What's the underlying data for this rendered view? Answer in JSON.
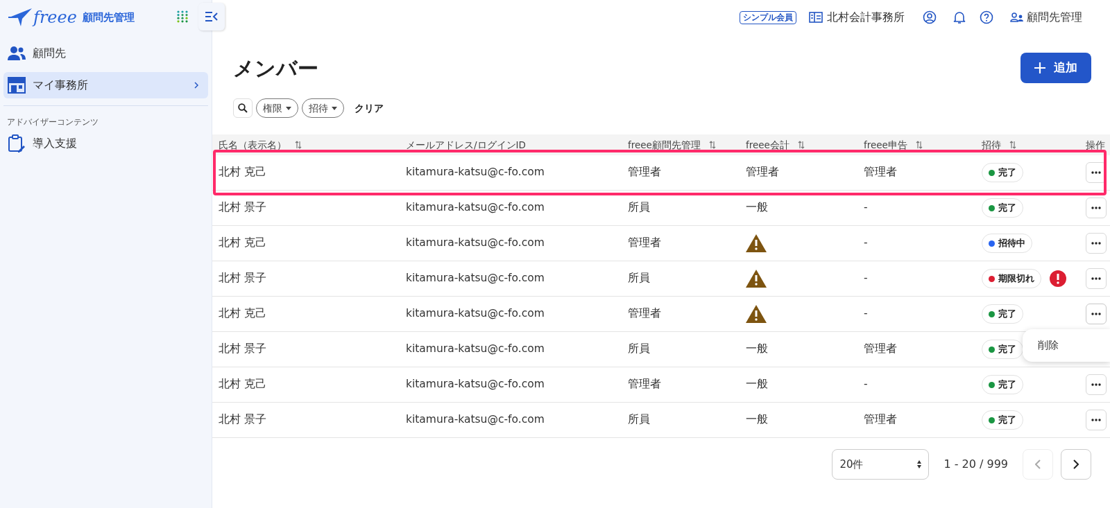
{
  "sidebar": {
    "logo": {
      "brand": "freee",
      "product": "顧問先管理"
    },
    "nav": [
      {
        "label": "顧問先",
        "kind": "people",
        "selected": false,
        "chevron": false
      },
      {
        "label": "マイ事務所",
        "kind": "shop",
        "selected": true,
        "chevron": true
      }
    ],
    "section_label": "アドバイザーコンテンツ",
    "section_items": [
      {
        "label": "導入支援",
        "kind": "clipboard"
      }
    ]
  },
  "topbar": {
    "plan_badge": "シンプル会員",
    "office": "北村会計事務所",
    "user_label": "顧問先管理"
  },
  "page": {
    "title": "メンバー",
    "add_button": "追加",
    "filters": [
      {
        "label": "権限"
      },
      {
        "label": "招待"
      }
    ],
    "clear": "クリア"
  },
  "table": {
    "columns": [
      {
        "label": "氏名（表示名）",
        "sortable": true
      },
      {
        "label": "メールアドレス/ログインID",
        "sortable": false
      },
      {
        "label": "freee顧問先管理",
        "sortable": true
      },
      {
        "label": "freee会計",
        "sortable": true
      },
      {
        "label": "freee申告",
        "sortable": true
      },
      {
        "label": "招待",
        "sortable": true
      },
      {
        "label": "操作",
        "sortable": false
      }
    ],
    "rows": [
      {
        "name": "北村 克己",
        "email": "kitamura-katsu@c-fo.com",
        "advisor": "管理者",
        "accounting": {
          "kind": "text",
          "text": "管理者"
        },
        "tax": "管理者",
        "invite": {
          "label": "完了",
          "color": "#1a9642",
          "alert": false
        },
        "highlighted": true,
        "actions_button": true,
        "menu_open": false
      },
      {
        "name": "北村 景子",
        "email": "kitamura-katsu@c-fo.com",
        "advisor": "所員",
        "accounting": {
          "kind": "text",
          "text": "一般"
        },
        "tax": "-",
        "invite": {
          "label": "完了",
          "color": "#1a9642",
          "alert": false
        },
        "highlighted": false,
        "actions_button": true,
        "menu_open": false
      },
      {
        "name": "北村 克己",
        "email": "kitamura-katsu@c-fo.com",
        "advisor": "管理者",
        "accounting": {
          "kind": "warning"
        },
        "tax": "-",
        "invite": {
          "label": "招待中",
          "color": "#2864f0",
          "alert": false
        },
        "highlighted": false,
        "actions_button": true,
        "menu_open": false
      },
      {
        "name": "北村 景子",
        "email": "kitamura-katsu@c-fo.com",
        "advisor": "所員",
        "accounting": {
          "kind": "warning"
        },
        "tax": "-",
        "invite": {
          "label": "期限切れ",
          "color": "#dc1e32",
          "alert": true
        },
        "highlighted": false,
        "actions_button": true,
        "menu_open": false
      },
      {
        "name": "北村 克己",
        "email": "kitamura-katsu@c-fo.com",
        "advisor": "管理者",
        "accounting": {
          "kind": "warning"
        },
        "tax": "-",
        "invite": {
          "label": "完了",
          "color": "#1a9642",
          "alert": false
        },
        "highlighted": false,
        "actions_button": true,
        "menu_open": true
      },
      {
        "name": "北村 景子",
        "email": "kitamura-katsu@c-fo.com",
        "advisor": "所員",
        "accounting": {
          "kind": "text",
          "text": "一般"
        },
        "tax": "管理者",
        "invite": {
          "label": "完了",
          "color": "#1a9642",
          "alert": false
        },
        "highlighted": false,
        "actions_button": false,
        "menu_open": false
      },
      {
        "name": "北村 克己",
        "email": "kitamura-katsu@c-fo.com",
        "advisor": "管理者",
        "accounting": {
          "kind": "text",
          "text": "一般"
        },
        "tax": "-",
        "invite": {
          "label": "完了",
          "color": "#1a9642",
          "alert": false
        },
        "highlighted": false,
        "actions_button": true,
        "menu_open": false
      },
      {
        "name": "北村 景子",
        "email": "kitamura-katsu@c-fo.com",
        "advisor": "所員",
        "accounting": {
          "kind": "text",
          "text": "一般"
        },
        "tax": "管理者",
        "invite": {
          "label": "完了",
          "color": "#1a9642",
          "alert": false
        },
        "highlighted": false,
        "actions_button": true,
        "menu_open": false
      }
    ],
    "row_menu": [
      "削除"
    ]
  },
  "pagination": {
    "page_size": "20件",
    "range": "1 - 20 / 999",
    "prev_disabled": true
  }
}
